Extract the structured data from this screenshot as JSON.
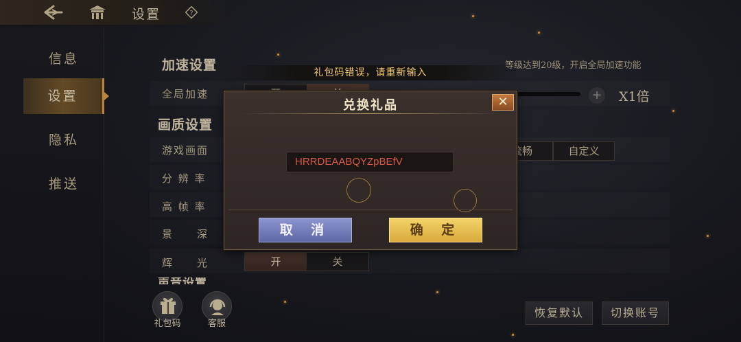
{
  "topbar": {
    "title": "设置",
    "back_icon": "back-arrow-icon",
    "home_icon": "pavilion-icon",
    "help_icon": "question-icon"
  },
  "sidebar": {
    "items": [
      {
        "label": "信息",
        "active": false
      },
      {
        "label": "设置",
        "active": true
      },
      {
        "label": "隐私",
        "active": false
      },
      {
        "label": "推送",
        "active": false
      }
    ]
  },
  "accel": {
    "title": "加速设置",
    "hint": "等级达到20级，开启全局加速功能",
    "global_label": "全局加速",
    "on_label": "开",
    "off_label": "关",
    "speed_value": "X1倍",
    "plus_label": "+"
  },
  "quality": {
    "title": "画质设置",
    "rows": [
      {
        "label": "游戏画面"
      },
      {
        "label": "分 辨 率"
      },
      {
        "label": "高 帧 率"
      },
      {
        "label": "景　　深"
      },
      {
        "label": "辉　　光"
      }
    ],
    "options": [
      "流畅",
      "自定义"
    ],
    "glow_on": "开",
    "glow_off": "关"
  },
  "partial_section_title": "声音设置",
  "bottom": {
    "gift_label": "礼包码",
    "service_label": "客服",
    "reset_label": "恢复默认",
    "switch_label": "切换账号"
  },
  "toast": {
    "message": "礼包码错误，请重新输入"
  },
  "dialog": {
    "title": "兑换礼品",
    "code_value": "HRRDEAABQYZpBEfV",
    "cancel_label": "取 消",
    "confirm_label": "确 定",
    "close_label": "✕"
  },
  "colors": {
    "accent": "#e3a24a",
    "error_text": "#d65a48",
    "toast_text": "#f0c86a",
    "cancel_blue": "#7c85c0",
    "confirm_gold": "#e8bf50"
  }
}
